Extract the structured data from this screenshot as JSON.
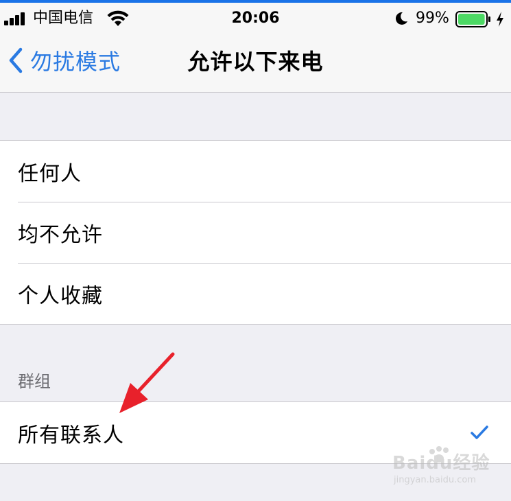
{
  "status_bar": {
    "carrier": "中国电信",
    "time": "20:06",
    "battery_percent": "99%",
    "battery_level": 0.99,
    "icons": [
      "signal-icon",
      "wifi-icon",
      "moon-icon",
      "battery-icon",
      "charging-bolt-icon"
    ]
  },
  "nav": {
    "back_label": "勿扰模式",
    "title": "允许以下来电"
  },
  "options": [
    {
      "label": "任何人"
    },
    {
      "label": "均不允许"
    },
    {
      "label": "个人收藏"
    }
  ],
  "groups_section": {
    "header": "群组",
    "items": [
      {
        "label": "所有联系人",
        "selected": true
      }
    ]
  },
  "watermark": {
    "brand": "Baidu经验",
    "url": "jingyan.baidu.com"
  },
  "colors": {
    "accent": "#2a7ae2",
    "annotation_arrow": "#e8212b",
    "background": "#efeff4",
    "battery": "#4cd964"
  }
}
